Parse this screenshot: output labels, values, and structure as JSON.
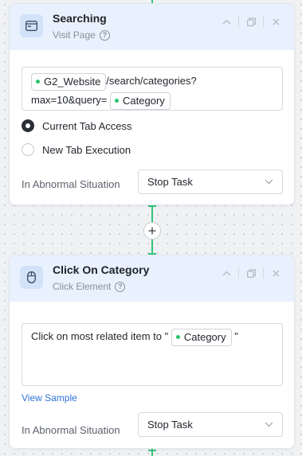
{
  "colors": {
    "accent_green": "#34c37a",
    "header_bg": "#e8f1fd",
    "link": "#2d72d9"
  },
  "cards": [
    {
      "icon": "browser-window-icon",
      "title": "Searching",
      "subtitle": "Visit Page",
      "url": {
        "chip_website": "G2_Website",
        "path": "/search/categories?",
        "query_prefix": "max=10&query=",
        "chip_query": "Category"
      },
      "options": [
        {
          "label": "Current Tab Access",
          "selected": true
        },
        {
          "label": "New Tab Execution",
          "selected": false
        }
      ],
      "abnormal_label": "In Abnormal Situation",
      "abnormal_value": "Stop Task"
    },
    {
      "icon": "mouse-icon",
      "title": "Click On Category",
      "subtitle": "Click Element",
      "instruction_prefix": "Click on most related item to \"",
      "instruction_chip": "Category",
      "instruction_suffix": "\"",
      "view_sample": "View Sample",
      "abnormal_label": "In Abnormal Situation",
      "abnormal_value": "Stop Task"
    }
  ]
}
